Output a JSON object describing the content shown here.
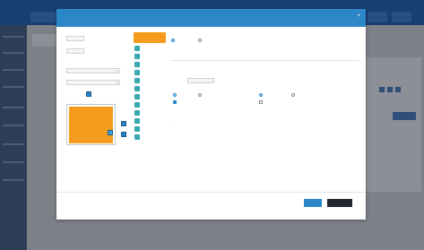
{
  "app": {
    "topbar_tabs": [
      "",
      "",
      ""
    ],
    "sidebar_items": [
      "",
      "",
      "",
      "",
      "",
      "",
      "",
      "",
      ""
    ],
    "right_button": ""
  },
  "modal": {
    "title": "",
    "close_icon": "close-icon",
    "left": {
      "field1_label": "",
      "field1_value": "",
      "field2_label": "",
      "field2_value": "",
      "field3_label": "",
      "field3_value": "",
      "field4_label": "",
      "field4_value": "",
      "upload_label": "",
      "preview_color": "#f59c1f"
    },
    "tools": {
      "header_label": "",
      "items": [
        "",
        "",
        "",
        "",
        "",
        "",
        "",
        "",
        "",
        "",
        "",
        "",
        ""
      ]
    },
    "settings": {
      "mode_option_1": "",
      "mode_option_2": "",
      "line_label": "",
      "line_value": "",
      "section_title": "",
      "group1_title": "",
      "group1_field": "",
      "group1_value": "",
      "group2_title": "",
      "group2_option_1": "",
      "group2_option_2": "",
      "group3_title": "",
      "group3_option_1": "",
      "group3_option_2": "",
      "checkbox_1": "",
      "checkbox_2": "",
      "footer_link": "…"
    },
    "buttons": {
      "primary": "",
      "secondary": ""
    }
  }
}
